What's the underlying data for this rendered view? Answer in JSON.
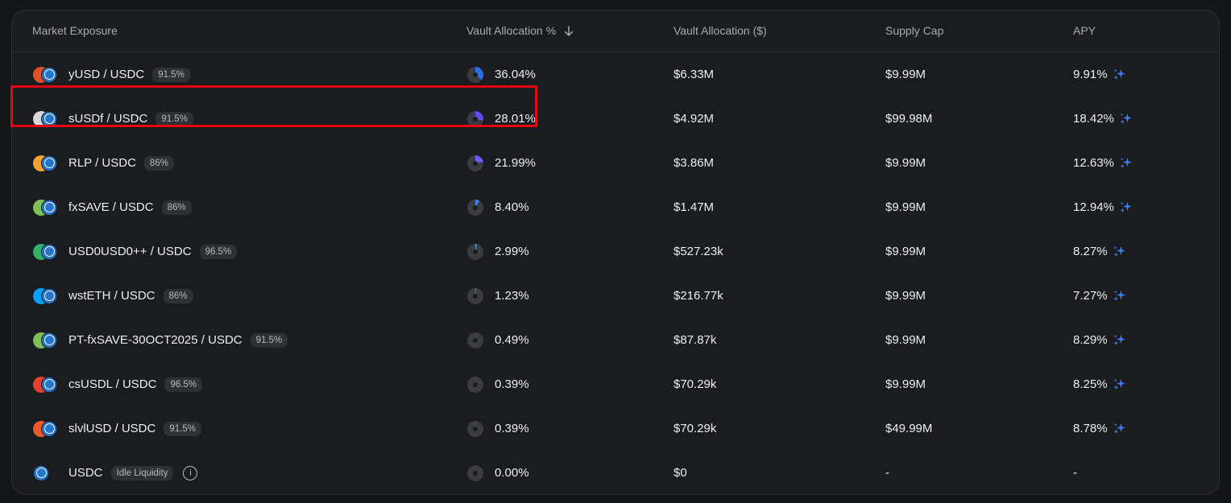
{
  "headers": {
    "market": "Market Exposure",
    "alloc_pct": "Vault Allocation %",
    "alloc_usd": "Vault Allocation ($)",
    "cap": "Supply Cap",
    "apy": "APY"
  },
  "sort_icon": "arrow-down-icon",
  "rows": [
    {
      "market": "yUSD / USDC",
      "badge": "91.5%",
      "alloc_pct": "36.04%",
      "fraction": 0.3604,
      "alloc_usd": "$6.33M",
      "cap": "$9.99M",
      "apy": "9.91%",
      "logo": "#e0522a",
      "pie": "#2a6fe8"
    },
    {
      "market": "sUSDf / USDC",
      "badge": "91.5%",
      "alloc_pct": "28.01%",
      "fraction": 0.2801,
      "alloc_usd": "$4.92M",
      "cap": "$99.98M",
      "apy": "18.42%",
      "logo": "#d8d8d8",
      "pie": "#5b4ef0"
    },
    {
      "market": "RLP / USDC",
      "badge": "86%",
      "alloc_pct": "21.99%",
      "fraction": 0.2199,
      "alloc_usd": "$3.86M",
      "cap": "$9.99M",
      "apy": "12.63%",
      "logo": "#f5a233",
      "pie": "#6a5cf5"
    },
    {
      "market": "fxSAVE / USDC",
      "badge": "86%",
      "alloc_pct": "8.40%",
      "fraction": 0.084,
      "alloc_usd": "$1.47M",
      "cap": "$9.99M",
      "apy": "12.94%",
      "logo": "#7fbf5a",
      "pie": "#3b8bf0"
    },
    {
      "market": "USD0USD0++ / USDC",
      "badge": "96.5%",
      "alloc_pct": "2.99%",
      "fraction": 0.0299,
      "alloc_usd": "$527.23k",
      "cap": "$9.99M",
      "apy": "8.27%",
      "logo": "#2fb36a",
      "pie": "#4aa3e8"
    },
    {
      "market": "wstETH / USDC",
      "badge": "86%",
      "alloc_pct": "1.23%",
      "fraction": 0.0123,
      "alloc_usd": "$216.77k",
      "cap": "$9.99M",
      "apy": "7.27%",
      "logo": "#00a3ff",
      "pie": "#8e9096"
    },
    {
      "market": "PT-fxSAVE-30OCT2025 / USDC",
      "badge": "91.5%",
      "alloc_pct": "0.49%",
      "fraction": 0.0049,
      "alloc_usd": "$87.87k",
      "cap": "$9.99M",
      "apy": "8.29%",
      "logo": "#7fbf5a",
      "pie": "#8e9096"
    },
    {
      "market": "csUSDL / USDC",
      "badge": "96.5%",
      "alloc_pct": "0.39%",
      "fraction": 0.0039,
      "alloc_usd": "$70.29k",
      "cap": "$9.99M",
      "apy": "8.25%",
      "logo": "#e4402f",
      "pie": "#8e9096"
    },
    {
      "market": "slvlUSD / USDC",
      "badge": "91.5%",
      "alloc_pct": "0.39%",
      "fraction": 0.0039,
      "alloc_usd": "$70.29k",
      "cap": "$49.99M",
      "apy": "8.78%",
      "logo": "#f05a28",
      "pie": "#8e9096"
    },
    {
      "market": "USDC",
      "badge": "Idle Liquidity",
      "alloc_pct": "0.00%",
      "fraction": 0,
      "alloc_usd": "$0",
      "cap": "-",
      "apy": "-",
      "logo": "",
      "pie": "#8e9096",
      "idle": true,
      "info_icon": "i"
    }
  ],
  "highlighted_row": "sUSDf / USDC",
  "colors": {
    "background": "#141517",
    "panel": "#1b1c1f",
    "apy_sparkle": "#3b82f6",
    "highlight": "#e30613"
  }
}
